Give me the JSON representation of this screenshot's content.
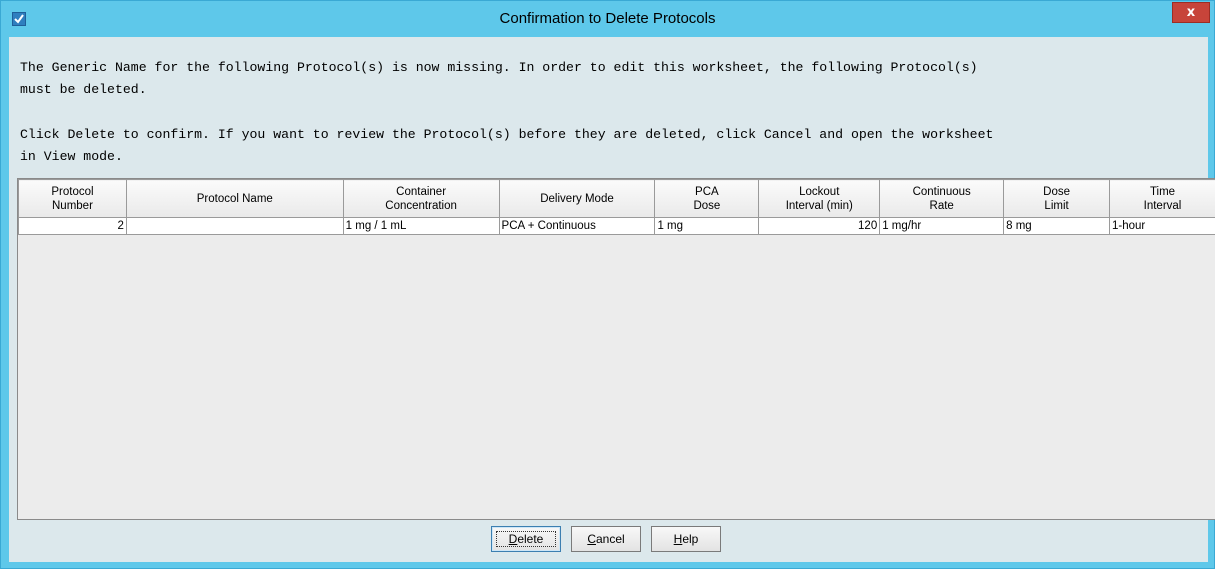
{
  "window": {
    "title": "Confirmation to Delete Protocols",
    "close_label": "x",
    "app_icon": "app-check-icon"
  },
  "message": {
    "line1": "The Generic Name for the following Protocol(s) is now missing. In order to edit this worksheet, the following Protocol(s)\nmust be deleted.",
    "line2": "Click Delete to confirm. If you want to review the Protocol(s) before they are deleted, click Cancel and open the worksheet\nin View mode."
  },
  "table": {
    "headers": [
      {
        "line1": "Protocol",
        "line2": "Number"
      },
      {
        "line1": "Protocol Name",
        "line2": ""
      },
      {
        "line1": "Container",
        "line2": "Concentration"
      },
      {
        "line1": "Delivery Mode",
        "line2": ""
      },
      {
        "line1": "PCA",
        "line2": "Dose"
      },
      {
        "line1": "Lockout",
        "line2": "Interval (min)"
      },
      {
        "line1": "Continuous",
        "line2": "Rate"
      },
      {
        "line1": "Dose",
        "line2": "Limit"
      },
      {
        "line1": "Time",
        "line2": "Interval"
      }
    ],
    "rows": [
      [
        "2",
        "",
        "1 mg / 1 mL",
        "PCA + Continuous",
        "1 mg",
        "120",
        "1 mg/hr",
        "8 mg",
        "1-hour"
      ]
    ]
  },
  "buttons": {
    "delete": {
      "label": "Delete",
      "mnemonic": "D"
    },
    "cancel": {
      "label": "Cancel",
      "mnemonic": "C"
    },
    "help": {
      "label": "Help",
      "mnemonic": "H"
    }
  },
  "colors": {
    "title_bar": "#5ec8ea",
    "client_background": "#dce8ec",
    "close_button": "#c7443a"
  }
}
